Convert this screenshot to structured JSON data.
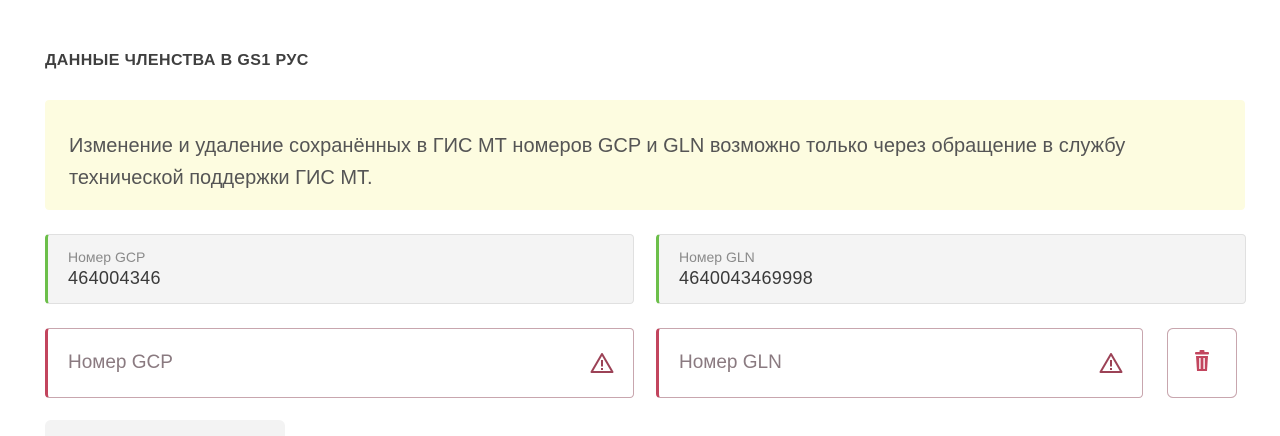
{
  "section": {
    "title": "ДАННЫЕ ЧЛЕНСТВА В GS1 РУС"
  },
  "notice": {
    "text": "Изменение и удаление сохранённых в ГИС МТ номеров GCP и GLN возможно только через обращение в службу технической поддержки ГИС МТ."
  },
  "saved": {
    "gcp": {
      "label": "Номер GCP",
      "value": "464004346"
    },
    "gln": {
      "label": "Номер GLN",
      "value": "4640043469998"
    }
  },
  "new_entry": {
    "gcp_placeholder": "Номер GCP",
    "gln_placeholder": "Номер GLN"
  },
  "icons": {
    "warning": "warning-triangle-icon",
    "delete": "trash-icon"
  },
  "colors": {
    "valid_accent": "#6cbf4a",
    "error_accent": "#c2455e",
    "notice_bg": "#fdfce0"
  }
}
